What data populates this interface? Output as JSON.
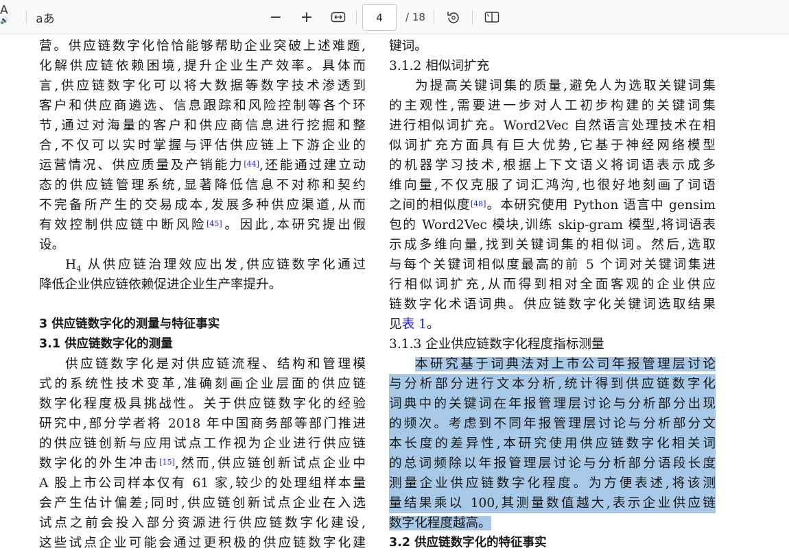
{
  "toolbar": {
    "read_aloud_icon": "A⁾",
    "text_options_icon": "aあ",
    "zoom_out_label": "−",
    "zoom_in_label": "+",
    "current_page": "4",
    "page_total": "/ 18"
  },
  "left_column": {
    "p1": [
      "营。供应链数字化恰恰能够帮助企业突破上述难题,",
      "化解供应链依赖困境,提升企业生产效率。具体而",
      "言,供应链数字化可以将大数据等数字技术渗透到",
      "客户和供应商遴选、信息跟踪和风险控制等各个环",
      "节,通过对海量的客户和供应商信息进行挖掘和整",
      "合,不仅可以实时掌握与评估供应链上下游企业的"
    ],
    "p1_line7_a": "运营情况、供应质量及产销能力",
    "p1_ref44": "[44]",
    "p1_line7_b": ",还能通过建立动",
    "p1_cont": [
      "态的供应链管理系统,显著降低信息不对称和契约",
      "不完备所产生的交易成本,发展多种供应渠道,从而"
    ],
    "p1_line10_a": "有效控制供应链中断风险",
    "p1_ref45": "[45]",
    "p1_line10_b": "。因此,本研究提出假",
    "p1_end": "设。",
    "h4_h": "H",
    "h4_sub": "4",
    "h4_line1": " 从供应链治理效应出发,供应链数字化通过",
    "h4_line2": "降低企业供应链依赖促进企业生产率提升。",
    "section3_title": "3  供应链数字化的测量与特征事实",
    "section31_title": "3.1  供应链数字化的测量",
    "p2": [
      "供应链数字化是对供应链流程、结构和管理模",
      "式的系统性技术变革,准确刻画企业层面的供应链",
      "数字化程度极具挑战性。关于供应链数字化的经验",
      "研究中,部分学者将 2018 年中国商务部等部门推进",
      "的供应链创新与应用试点工作视为企业进行供应链"
    ],
    "p2_line6_a": "数字化的外生冲击",
    "p2_ref15": "[15]",
    "p2_line6_b": ",然而,供应链创新试点企业中",
    "p2_cont": [
      "A 股上市公司样本仅有 61 家,较少的处理组样本量",
      "会产生估计偏差;同时,供应链创新试点企业在入选",
      "试点之前会投入部分资源进行供应链数字化建设,",
      "这些试点企业可能会通过更积极的供应链数字化建"
    ]
  },
  "right_column": {
    "top_line": "键词。",
    "section312_title": "3.1.2  相似词扩充",
    "p3": [
      "为提高关键词集的质量,避免人为选取关键词集",
      "的主观性,需要进一步对人工初步构建的关键词集",
      "进行相似词扩充。Word2Vec 自然语言处理技术在相",
      "似词扩充方面具有巨大优势,它基于神经网络模型",
      "的机器学习技术,根据上下文语义将词语表示成多",
      "维向量,不仅克服了词汇鸿沟,也很好地刻画了词语"
    ],
    "p3_line7_a": "之间的相似度",
    "p3_ref48": "[48]",
    "p3_line7_b": "。本研究使用 Python 语言中 gensim",
    "p3_cont": [
      "包的 Word2Vec 模块,训练 skip-gram 模型,将词语表",
      "示成多维向量,找到关键词集的相似词。然后,选取",
      "与每个关键词相似度最高的前 5 个词对关键词集进",
      "行相似词扩充,从而得到相对全面客观的企业供应",
      "链数字化术语词典。供应链数字化关键词选取结果"
    ],
    "p3_end_a": "见",
    "p3_end_link": "表 1",
    "p3_end_b": "。",
    "section313_title": "3.1.3  企业供应链数字化程度指标测量",
    "p4": [
      "本研究基于词典法对上市公司年报管理层讨论",
      "与分析部分进行文本分析,统计得到供应链数字化",
      "词典中的关键词在年报管理层讨论与分析部分出现",
      "的频次。考虑到不同年报管理层讨论与分析部分文",
      "本长度的差异性,本研究使用供应链数字化相关词",
      "的总词频除以年报管理层讨论与分析部分语段长度",
      "测量企业供应链数字化程度。为方便表述,将该测",
      "量结果乘以 100,其测量数值越大,表示企业供应链"
    ],
    "p4_end": "数字化程度越高。",
    "section32_partial": "3.2  供应链数字化的特征事实"
  },
  "colors": {
    "highlight": "#a7c8e6",
    "link": "#1a1aff",
    "toolbar_bg": "#f9f9f9"
  }
}
